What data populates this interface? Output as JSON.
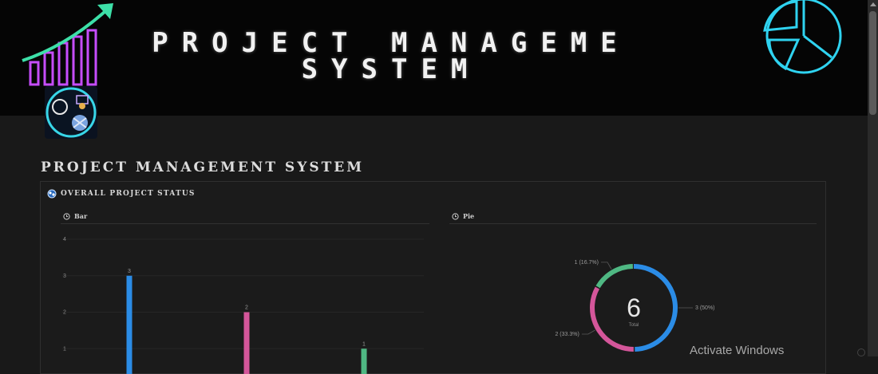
{
  "banner": {
    "title_line1": "PROJECT MANAGEME",
    "title_line2": "SYSTEM"
  },
  "page": {
    "title": "PROJECT MANAGEMENT SYSTEM"
  },
  "status_section": {
    "title": "OVERALL PROJECT STATUS"
  },
  "bar_view": {
    "label": "Bar",
    "chart_data": {
      "type": "bar",
      "categories": [
        "",
        "",
        ""
      ],
      "values": [
        3,
        2,
        1
      ],
      "colors": [
        "#2b8ce6",
        "#d4569a",
        "#4fb883"
      ],
      "ylim": [
        0,
        4
      ],
      "yticks": [
        "1",
        "2",
        "3",
        "4"
      ],
      "grid": true
    }
  },
  "pie_view": {
    "label": "Pie",
    "chart_data": {
      "type": "pie",
      "values": [
        3,
        2,
        1
      ],
      "colors": [
        "#2b8ce6",
        "#d4569a",
        "#4fb883"
      ],
      "slice_labels": [
        "3 (50%)",
        "2 (33.3%)",
        "1 (16.7%)"
      ],
      "total_value": "6",
      "total_label": "Total"
    }
  },
  "overlay": {
    "activate_windows": "Activate Windows"
  }
}
